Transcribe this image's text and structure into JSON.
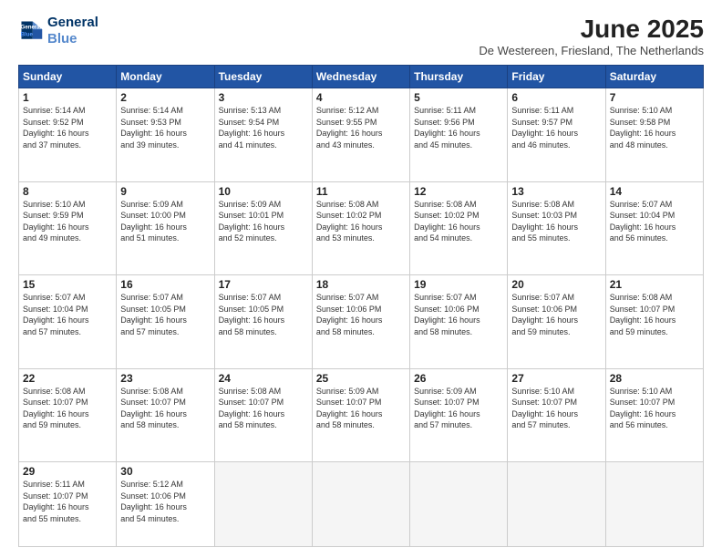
{
  "logo": {
    "line1": "General",
    "line2": "Blue"
  },
  "title": "June 2025",
  "location": "De Westereen, Friesland, The Netherlands",
  "days_header": [
    "Sunday",
    "Monday",
    "Tuesday",
    "Wednesday",
    "Thursday",
    "Friday",
    "Saturday"
  ],
  "weeks": [
    [
      {
        "day": "1",
        "info": "Sunrise: 5:14 AM\nSunset: 9:52 PM\nDaylight: 16 hours\nand 37 minutes."
      },
      {
        "day": "2",
        "info": "Sunrise: 5:14 AM\nSunset: 9:53 PM\nDaylight: 16 hours\nand 39 minutes."
      },
      {
        "day": "3",
        "info": "Sunrise: 5:13 AM\nSunset: 9:54 PM\nDaylight: 16 hours\nand 41 minutes."
      },
      {
        "day": "4",
        "info": "Sunrise: 5:12 AM\nSunset: 9:55 PM\nDaylight: 16 hours\nand 43 minutes."
      },
      {
        "day": "5",
        "info": "Sunrise: 5:11 AM\nSunset: 9:56 PM\nDaylight: 16 hours\nand 45 minutes."
      },
      {
        "day": "6",
        "info": "Sunrise: 5:11 AM\nSunset: 9:57 PM\nDaylight: 16 hours\nand 46 minutes."
      },
      {
        "day": "7",
        "info": "Sunrise: 5:10 AM\nSunset: 9:58 PM\nDaylight: 16 hours\nand 48 minutes."
      }
    ],
    [
      {
        "day": "8",
        "info": "Sunrise: 5:10 AM\nSunset: 9:59 PM\nDaylight: 16 hours\nand 49 minutes."
      },
      {
        "day": "9",
        "info": "Sunrise: 5:09 AM\nSunset: 10:00 PM\nDaylight: 16 hours\nand 51 minutes."
      },
      {
        "day": "10",
        "info": "Sunrise: 5:09 AM\nSunset: 10:01 PM\nDaylight: 16 hours\nand 52 minutes."
      },
      {
        "day": "11",
        "info": "Sunrise: 5:08 AM\nSunset: 10:02 PM\nDaylight: 16 hours\nand 53 minutes."
      },
      {
        "day": "12",
        "info": "Sunrise: 5:08 AM\nSunset: 10:02 PM\nDaylight: 16 hours\nand 54 minutes."
      },
      {
        "day": "13",
        "info": "Sunrise: 5:08 AM\nSunset: 10:03 PM\nDaylight: 16 hours\nand 55 minutes."
      },
      {
        "day": "14",
        "info": "Sunrise: 5:07 AM\nSunset: 10:04 PM\nDaylight: 16 hours\nand 56 minutes."
      }
    ],
    [
      {
        "day": "15",
        "info": "Sunrise: 5:07 AM\nSunset: 10:04 PM\nDaylight: 16 hours\nand 57 minutes."
      },
      {
        "day": "16",
        "info": "Sunrise: 5:07 AM\nSunset: 10:05 PM\nDaylight: 16 hours\nand 57 minutes."
      },
      {
        "day": "17",
        "info": "Sunrise: 5:07 AM\nSunset: 10:05 PM\nDaylight: 16 hours\nand 58 minutes."
      },
      {
        "day": "18",
        "info": "Sunrise: 5:07 AM\nSunset: 10:06 PM\nDaylight: 16 hours\nand 58 minutes."
      },
      {
        "day": "19",
        "info": "Sunrise: 5:07 AM\nSunset: 10:06 PM\nDaylight: 16 hours\nand 58 minutes."
      },
      {
        "day": "20",
        "info": "Sunrise: 5:07 AM\nSunset: 10:06 PM\nDaylight: 16 hours\nand 59 minutes."
      },
      {
        "day": "21",
        "info": "Sunrise: 5:08 AM\nSunset: 10:07 PM\nDaylight: 16 hours\nand 59 minutes."
      }
    ],
    [
      {
        "day": "22",
        "info": "Sunrise: 5:08 AM\nSunset: 10:07 PM\nDaylight: 16 hours\nand 59 minutes."
      },
      {
        "day": "23",
        "info": "Sunrise: 5:08 AM\nSunset: 10:07 PM\nDaylight: 16 hours\nand 58 minutes."
      },
      {
        "day": "24",
        "info": "Sunrise: 5:08 AM\nSunset: 10:07 PM\nDaylight: 16 hours\nand 58 minutes."
      },
      {
        "day": "25",
        "info": "Sunrise: 5:09 AM\nSunset: 10:07 PM\nDaylight: 16 hours\nand 58 minutes."
      },
      {
        "day": "26",
        "info": "Sunrise: 5:09 AM\nSunset: 10:07 PM\nDaylight: 16 hours\nand 57 minutes."
      },
      {
        "day": "27",
        "info": "Sunrise: 5:10 AM\nSunset: 10:07 PM\nDaylight: 16 hours\nand 57 minutes."
      },
      {
        "day": "28",
        "info": "Sunrise: 5:10 AM\nSunset: 10:07 PM\nDaylight: 16 hours\nand 56 minutes."
      }
    ],
    [
      {
        "day": "29",
        "info": "Sunrise: 5:11 AM\nSunset: 10:07 PM\nDaylight: 16 hours\nand 55 minutes."
      },
      {
        "day": "30",
        "info": "Sunrise: 5:12 AM\nSunset: 10:06 PM\nDaylight: 16 hours\nand 54 minutes."
      },
      {
        "day": "",
        "info": ""
      },
      {
        "day": "",
        "info": ""
      },
      {
        "day": "",
        "info": ""
      },
      {
        "day": "",
        "info": ""
      },
      {
        "day": "",
        "info": ""
      }
    ]
  ]
}
